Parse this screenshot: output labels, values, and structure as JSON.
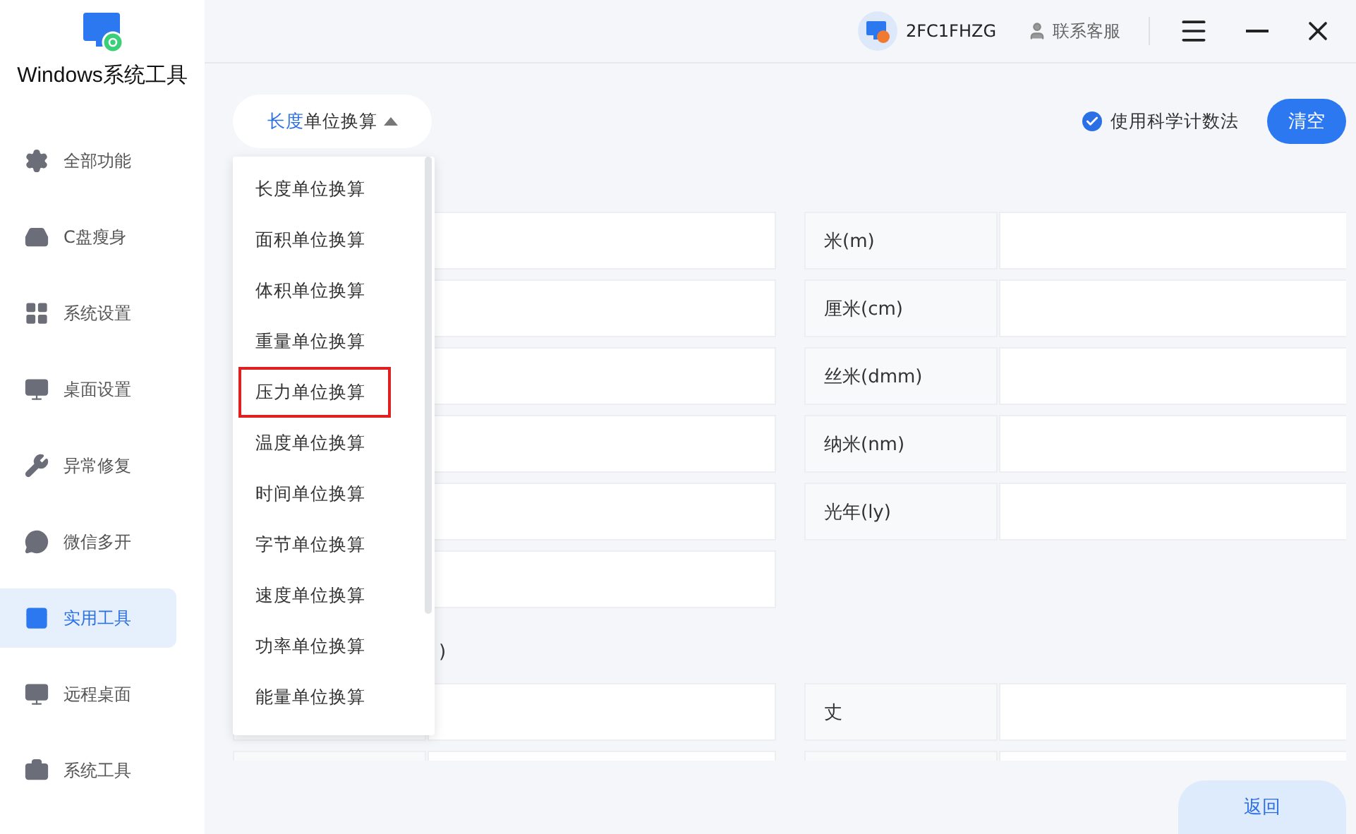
{
  "app": {
    "title": "Windows系统工具"
  },
  "sidebar": {
    "items": [
      {
        "label": "全部功能",
        "selected": false
      },
      {
        "label": "C盘瘦身",
        "selected": false
      },
      {
        "label": "系统设置",
        "selected": false
      },
      {
        "label": "桌面设置",
        "selected": false
      },
      {
        "label": "异常修复",
        "selected": false
      },
      {
        "label": "微信多开",
        "selected": false
      },
      {
        "label": "实用工具",
        "selected": true
      },
      {
        "label": "远程桌面",
        "selected": false
      },
      {
        "label": "系统工具",
        "selected": false
      }
    ]
  },
  "topbar": {
    "device_id": "2FC1FHZG",
    "support": "联系客服"
  },
  "converter": {
    "trigger": {
      "accent": "长度",
      "rest": "单位换算",
      "expanded": true
    },
    "scientific": {
      "label": "使用科学计数法",
      "checked": true
    },
    "clear_button": "清空",
    "menu": [
      {
        "label": "长度单位换算",
        "highlighted": false
      },
      {
        "label": "面积单位换算",
        "highlighted": false
      },
      {
        "label": "体积单位换算",
        "highlighted": false
      },
      {
        "label": "重量单位换算",
        "highlighted": false
      },
      {
        "label": "压力单位换算",
        "highlighted": true
      },
      {
        "label": "温度单位换算",
        "highlighted": false
      },
      {
        "label": "时间单位换算",
        "highlighted": false
      },
      {
        "label": "字节单位换算",
        "highlighted": false
      },
      {
        "label": "速度单位换算",
        "highlighted": false
      },
      {
        "label": "功率单位换算",
        "highlighted": false
      },
      {
        "label": "能量单位换算",
        "highlighted": false
      }
    ],
    "sections": [
      {
        "rows": [
          {
            "kind": "pair",
            "label": "米(m)"
          },
          {
            "kind": "pair",
            "label": "厘米(cm)"
          },
          {
            "kind": "pair",
            "label": "丝米(dmm)"
          },
          {
            "kind": "pair",
            "label": "纳米(nm)"
          },
          {
            "kind": "pair",
            "label": "光年(ly)"
          },
          {
            "kind": "left-only"
          }
        ]
      },
      {
        "title": ")",
        "rows": [
          {
            "kind": "pair",
            "label": "丈"
          },
          {
            "kind": "pair"
          }
        ]
      }
    ],
    "back_button": "返回"
  }
}
